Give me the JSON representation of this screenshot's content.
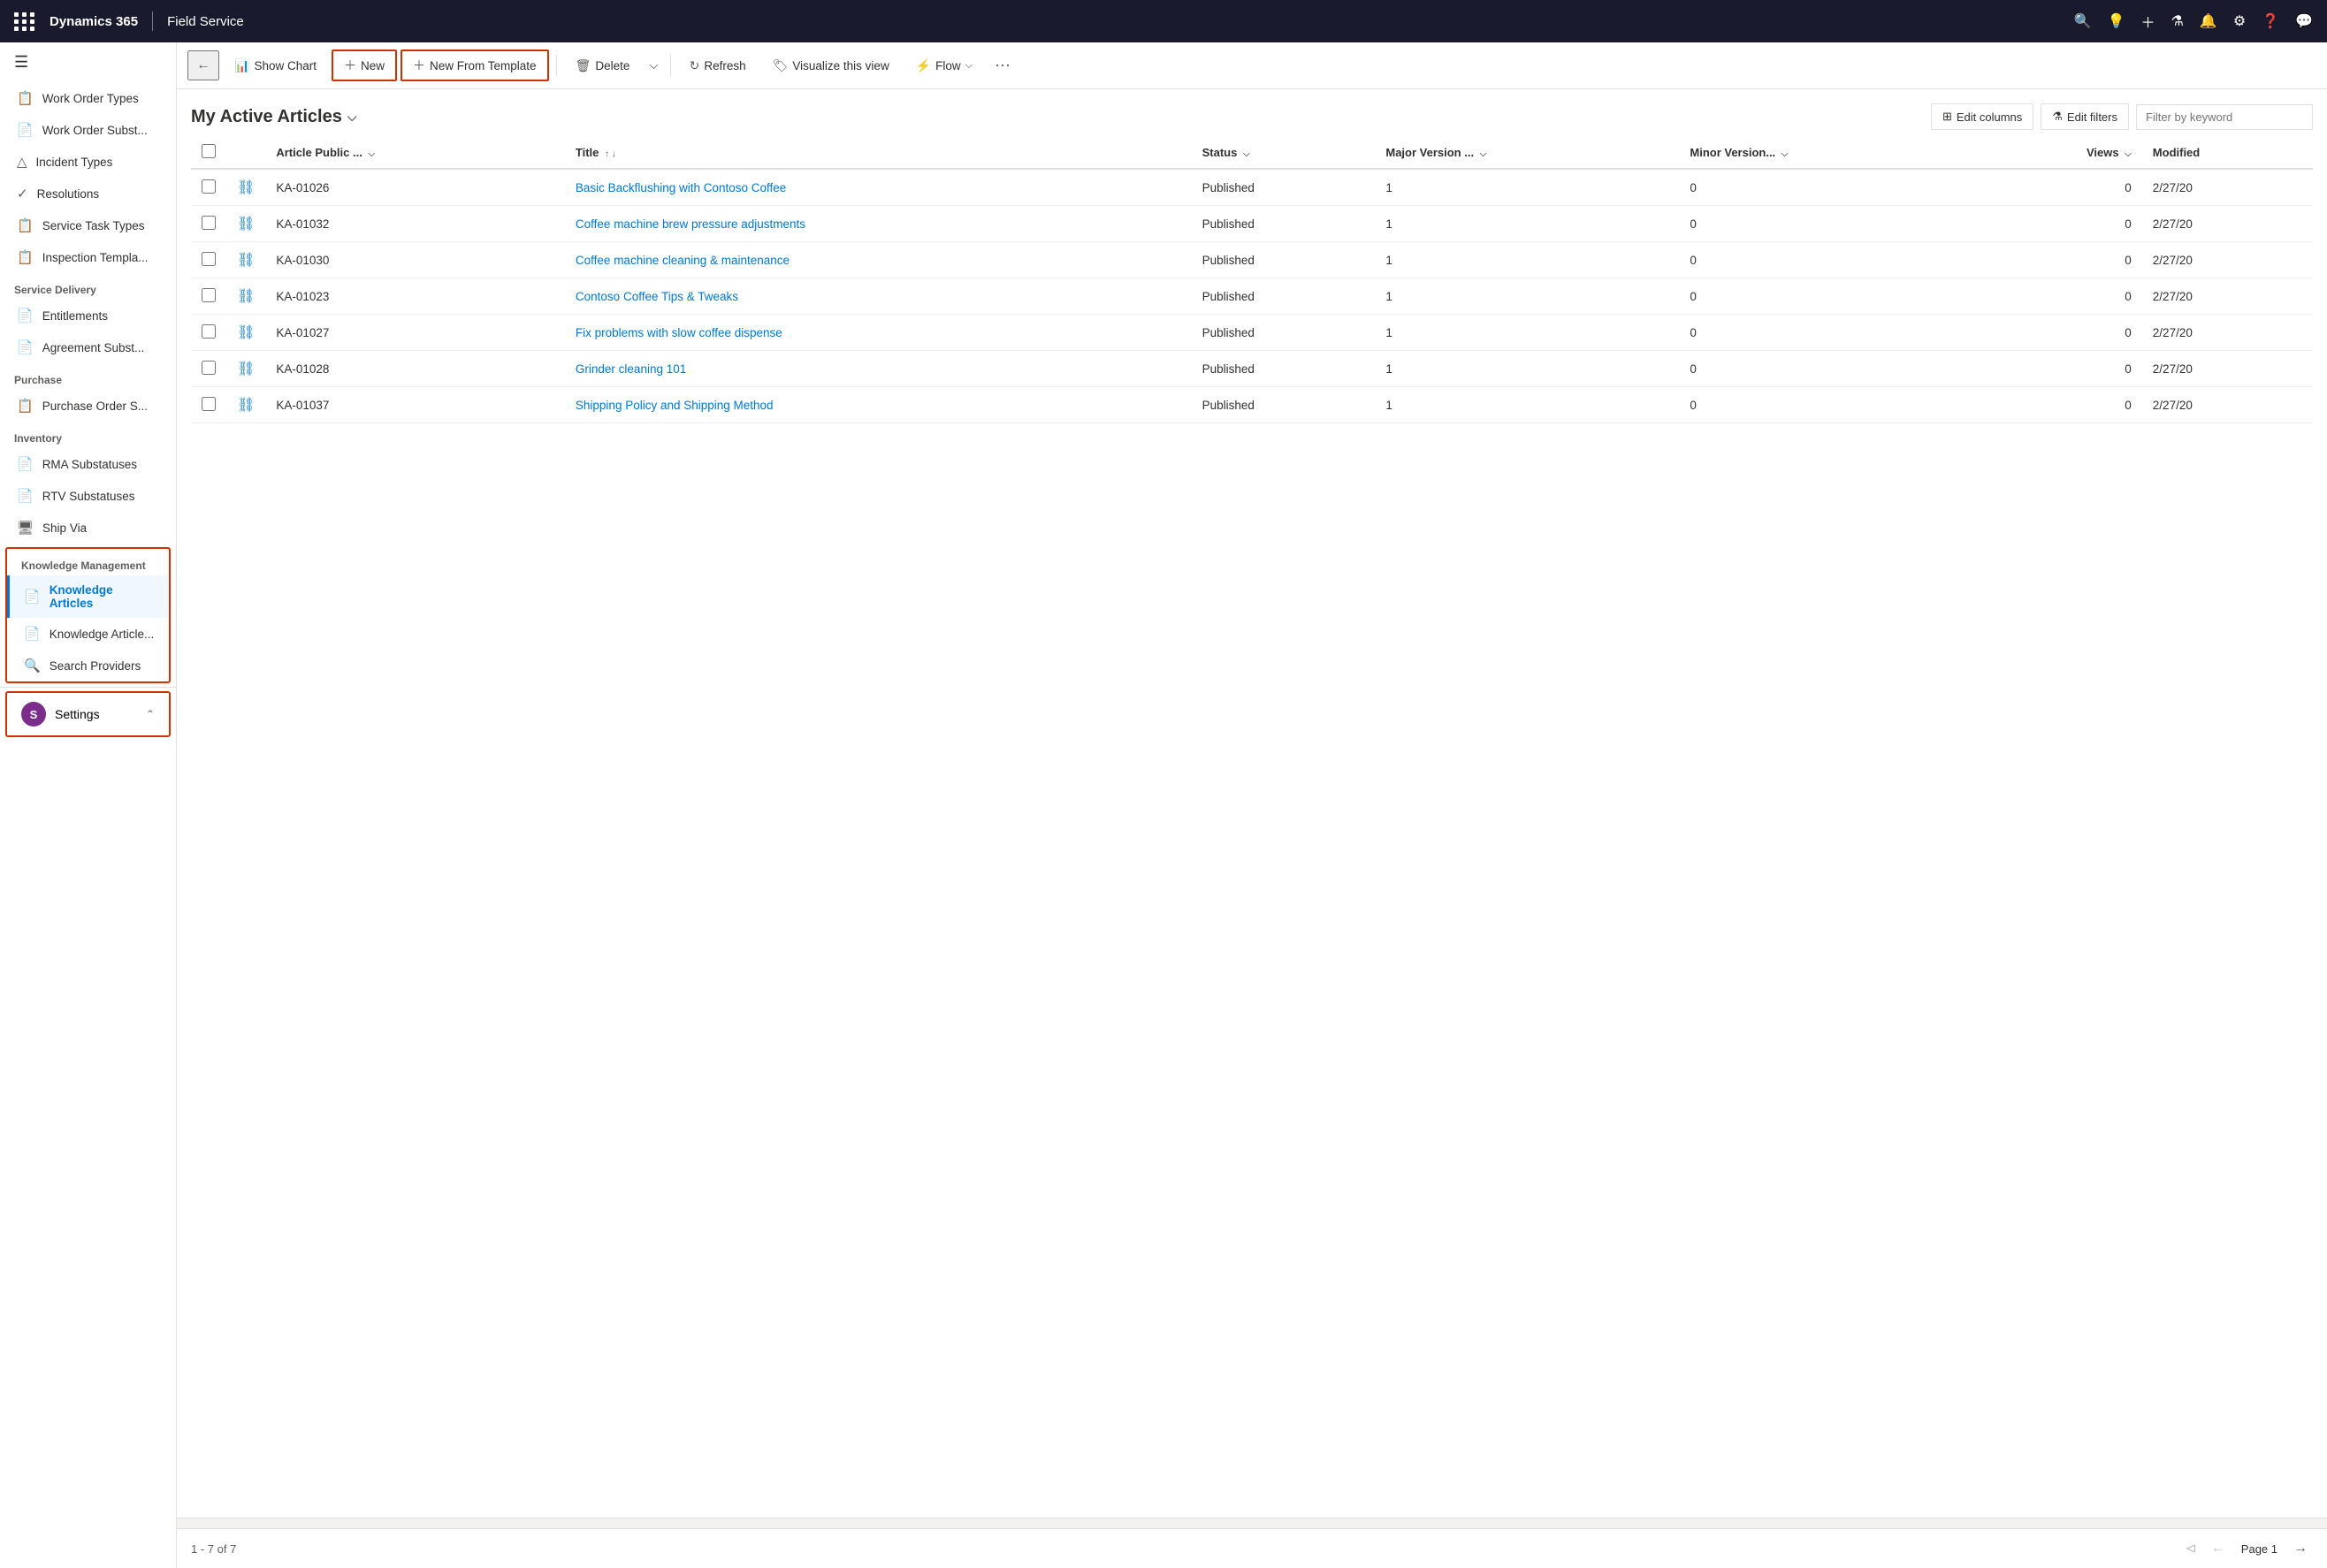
{
  "app": {
    "brand": "Dynamics 365",
    "separator": "|",
    "module": "Field Service"
  },
  "topnav": {
    "icons": [
      "search",
      "lightbulb",
      "plus",
      "filter",
      "bell",
      "settings",
      "help",
      "chat"
    ]
  },
  "sidebar": {
    "hamburger": "☰",
    "items": [
      {
        "id": "work-order-types",
        "label": "Work Order Types",
        "icon": "📋"
      },
      {
        "id": "work-order-subst",
        "label": "Work Order Subst...",
        "icon": "📄"
      },
      {
        "id": "incident-types",
        "label": "Incident Types",
        "icon": "△"
      },
      {
        "id": "resolutions",
        "label": "Resolutions",
        "icon": "✓"
      },
      {
        "id": "service-task-types",
        "label": "Service Task Types",
        "icon": "📋"
      },
      {
        "id": "inspection-templa",
        "label": "Inspection Templa...",
        "icon": "📋"
      }
    ],
    "sections": [
      {
        "label": "Service Delivery",
        "items": [
          {
            "id": "entitlements",
            "label": "Entitlements",
            "icon": "📄"
          },
          {
            "id": "agreement-subst",
            "label": "Agreement Subst...",
            "icon": "📄"
          }
        ]
      },
      {
        "label": "Purchase",
        "items": [
          {
            "id": "purchase-order-s",
            "label": "Purchase Order S...",
            "icon": "📋"
          }
        ]
      },
      {
        "label": "Inventory",
        "items": [
          {
            "id": "rma-substatuses",
            "label": "RMA Substatuses",
            "icon": "📄"
          },
          {
            "id": "rtv-substatuses",
            "label": "RTV Substatuses",
            "icon": "📄"
          },
          {
            "id": "ship-via",
            "label": "Ship Via",
            "icon": "🖥"
          }
        ]
      }
    ],
    "knowledge_section": {
      "label": "Knowledge Management",
      "items": [
        {
          "id": "knowledge-articles",
          "label": "Knowledge Articles",
          "icon": "📄",
          "active": true
        },
        {
          "id": "knowledge-article-t",
          "label": "Knowledge Article...",
          "icon": "📄"
        },
        {
          "id": "search-providers",
          "label": "Search Providers",
          "icon": "🔍"
        }
      ]
    },
    "settings": {
      "label": "Settings",
      "avatar_letter": "S",
      "avatar_color": "#7b2d8b",
      "expand_icon": "⌃"
    }
  },
  "toolbar": {
    "back_label": "←",
    "show_chart_label": "Show Chart",
    "new_label": "New",
    "new_from_template_label": "New From Template",
    "delete_label": "Delete",
    "refresh_label": "Refresh",
    "visualize_label": "Visualize this view",
    "flow_label": "Flow",
    "more_label": "⋯"
  },
  "view": {
    "title": "My Active Articles",
    "title_chevron": "⌵",
    "edit_columns_label": "Edit columns",
    "edit_filters_label": "Edit filters",
    "filter_placeholder": "Filter by keyword"
  },
  "table": {
    "columns": [
      {
        "id": "article_public_num",
        "label": "Article Public ...",
        "sortable": true
      },
      {
        "id": "title",
        "label": "Title",
        "sortable": true,
        "sort_direction": "asc"
      },
      {
        "id": "status",
        "label": "Status",
        "sortable": true
      },
      {
        "id": "major_version",
        "label": "Major Version ...",
        "sortable": true
      },
      {
        "id": "minor_version",
        "label": "Minor Version...",
        "sortable": true
      },
      {
        "id": "views",
        "label": "Views",
        "sortable": true
      },
      {
        "id": "modified",
        "label": "Modified",
        "sortable": false
      }
    ],
    "rows": [
      {
        "num": "KA-01026",
        "title": "Basic Backflushing with Contoso Coffee",
        "status": "Published",
        "major_version": "1",
        "minor_version": "0",
        "views": "0",
        "modified": "2/27/20"
      },
      {
        "num": "KA-01032",
        "title": "Coffee machine brew pressure adjustments",
        "status": "Published",
        "major_version": "1",
        "minor_version": "0",
        "views": "0",
        "modified": "2/27/20"
      },
      {
        "num": "KA-01030",
        "title": "Coffee machine cleaning & maintenance",
        "status": "Published",
        "major_version": "1",
        "minor_version": "0",
        "views": "0",
        "modified": "2/27/20"
      },
      {
        "num": "KA-01023",
        "title": "Contoso Coffee Tips & Tweaks",
        "status": "Published",
        "major_version": "1",
        "minor_version": "0",
        "views": "0",
        "modified": "2/27/20"
      },
      {
        "num": "KA-01027",
        "title": "Fix problems with slow coffee dispense",
        "status": "Published",
        "major_version": "1",
        "minor_version": "0",
        "views": "0",
        "modified": "2/27/20"
      },
      {
        "num": "KA-01028",
        "title": "Grinder cleaning 101",
        "status": "Published",
        "major_version": "1",
        "minor_version": "0",
        "views": "0",
        "modified": "2/27/20"
      },
      {
        "num": "KA-01037",
        "title": "Shipping Policy and Shipping Method",
        "status": "Published",
        "major_version": "1",
        "minor_version": "0",
        "views": "0",
        "modified": "2/27/20"
      }
    ]
  },
  "footer": {
    "count_label": "1 - 7 of 7",
    "page_label": "Page 1"
  }
}
